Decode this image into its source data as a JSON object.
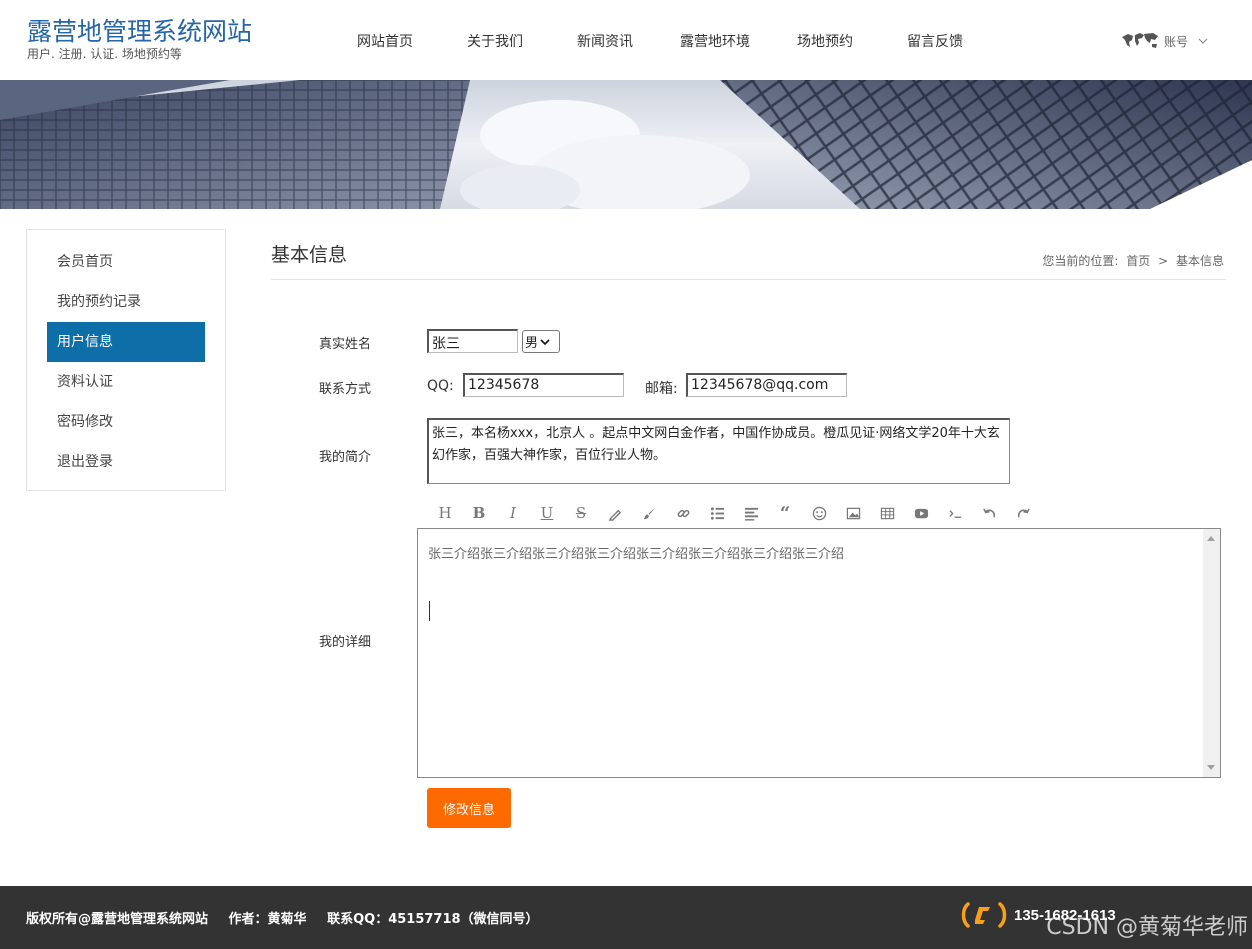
{
  "site": {
    "title": "露营地管理系统网站",
    "subtitle": "用户. 注册. 认证. 场地预约等"
  },
  "nav": {
    "items": [
      "网站首页",
      "关于我们",
      "新闻资讯",
      "露营地环境",
      "场地预约",
      "留言反馈"
    ]
  },
  "account": {
    "label": "账号"
  },
  "sidebar": {
    "items": [
      {
        "label": "会员首页"
      },
      {
        "label": "我的预约记录"
      },
      {
        "label": "用户信息"
      },
      {
        "label": "资料认证"
      },
      {
        "label": "密码修改"
      },
      {
        "label": "退出登录"
      }
    ],
    "active": "用户信息"
  },
  "content": {
    "title": "基本信息",
    "breadcrumb": {
      "prefix": "您当前的位置:",
      "home": "首页",
      "sep": ">",
      "current": "基本信息"
    }
  },
  "form": {
    "name_label": "真实姓名",
    "name_value": "张三",
    "gender_value": "男",
    "contact_label": "联系方式",
    "qq_label": "QQ:",
    "qq_value": "12345678",
    "email_label": "邮箱:",
    "email_value": "12345678@qq.com",
    "intro_label": "我的简介",
    "intro_value": "张三，本名杨xxx，北京人 。起点中文网白金作者，中国作协成员。橙瓜见证·网络文学20年十大玄幻作家，百强大神作家，百位行业人物。",
    "detail_label": "我的详细",
    "detail_value": "张三介绍张三介绍张三介绍张三介绍张三介绍张三介绍张三介绍张三介绍",
    "submit_label": "修改信息"
  },
  "toolbar": {
    "tools": [
      "heading-icon",
      "bold-icon",
      "italic-icon",
      "underline-icon",
      "strikethrough-icon",
      "highlight-icon",
      "brush-icon",
      "link-icon",
      "bullet-list-icon",
      "align-left-icon",
      "quote-icon",
      "emoji-icon",
      "image-icon",
      "table-icon",
      "video-icon",
      "code-icon",
      "undo-icon",
      "redo-icon"
    ]
  },
  "footer": {
    "copyright": "版权所有@露营地管理系统网站",
    "author": "作者：黄菊华",
    "contact": "联系QQ：45157718（微信同号）",
    "phone": "135-1682-1613",
    "watermark": "CSDN @黄菊华老师"
  },
  "colors": {
    "brand": "#2466a8",
    "active": "#0e6ea8",
    "button": "#ff6a00",
    "footer": "#333333",
    "phone_icon": "#f7a11a"
  }
}
